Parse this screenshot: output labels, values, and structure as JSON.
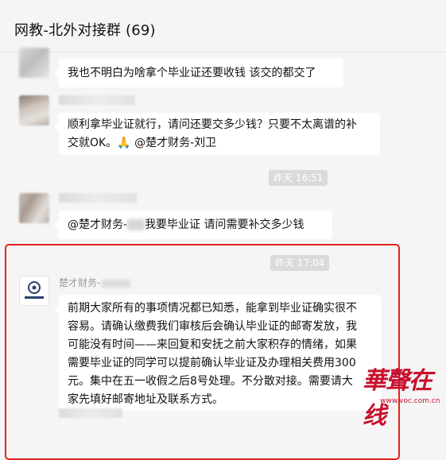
{
  "window": {
    "title": "网教-北外对接群 (69)"
  },
  "messages": [
    {
      "text": "我也不明白为啥拿个毕业证还要收钱    该交的都交了"
    },
    {
      "text_line1": "顺利拿毕业证就行，请问还要交多少钱？只要不太离谱的补",
      "text_line2": "交就OK。🙏 @楚才财务-刘卫"
    },
    {
      "time": "昨天 16:51"
    },
    {
      "text_a": "@楚才财务-",
      "text_b": "我要毕业证 请问需要补交多少钱"
    },
    {
      "time": "昨天 17:04"
    },
    {
      "sender": "楚才财务-",
      "lines": [
        "前期大家所有的事项情况都已知悉，能拿到毕业证确实很不",
        "容易。请确认缴费我们审核后会确认毕业证的邮寄发放，我",
        "可能没有时间——来回复和安抚之前大家积存的情绪，如果",
        "需要毕业证的同学可以提前确认毕业证及办理相关费用300",
        "元。集中在五一收假之后8号处理。不分散对接。需要请大",
        "家先填好邮寄地址及联系方式。"
      ]
    }
  ],
  "watermark": {
    "text": "華聲在线",
    "url": "www.voc.com.cn"
  },
  "colors": {
    "highlight_border": "#e2231a",
    "watermark": "#c8102e",
    "bubble": "#ffffff",
    "background": "#f5f5f5"
  }
}
